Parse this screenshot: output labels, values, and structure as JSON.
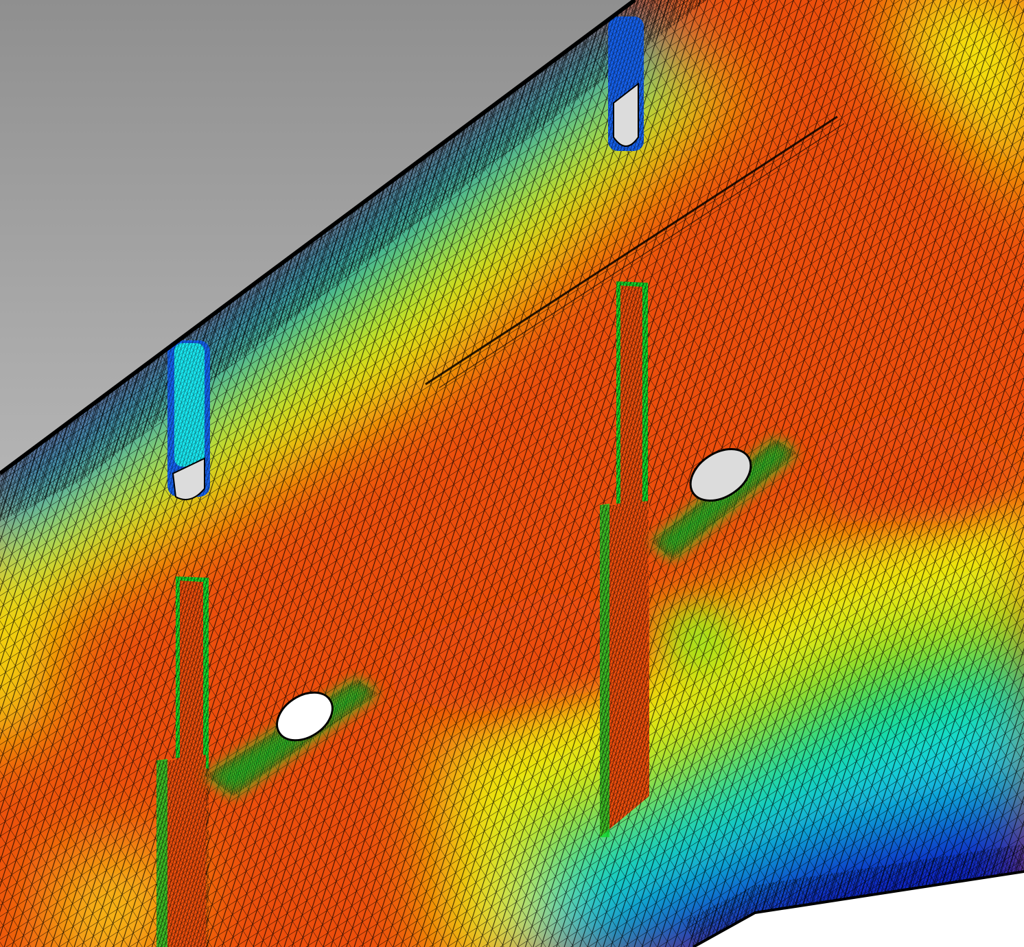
{
  "view": {
    "background_gradient": [
      "#8f8f8f",
      "#d9d9d9"
    ],
    "colormap": [
      "#0b22c8",
      "#1560ea",
      "#19e6f0",
      "#12d62a",
      "#9ce81a",
      "#f4ee10",
      "#f7a11a",
      "#ec4e0c"
    ],
    "mesh_line_color": "#000000",
    "hole_fill_color": "#dcdcdc",
    "hole_fill_color_bright": "#ffffff"
  },
  "features": [
    {
      "name": "upper-slot-right",
      "kind": "slot-cutout"
    },
    {
      "name": "upper-slot-left",
      "kind": "slot-cutout"
    },
    {
      "name": "stiffener-left",
      "kind": "vertical-stiffener"
    },
    {
      "name": "stiffener-right",
      "kind": "vertical-stiffener"
    },
    {
      "name": "oval-hole-left",
      "kind": "oval-hole"
    },
    {
      "name": "oval-hole-right",
      "kind": "oval-hole"
    },
    {
      "name": "weld-line-diagonal",
      "kind": "seam"
    }
  ]
}
